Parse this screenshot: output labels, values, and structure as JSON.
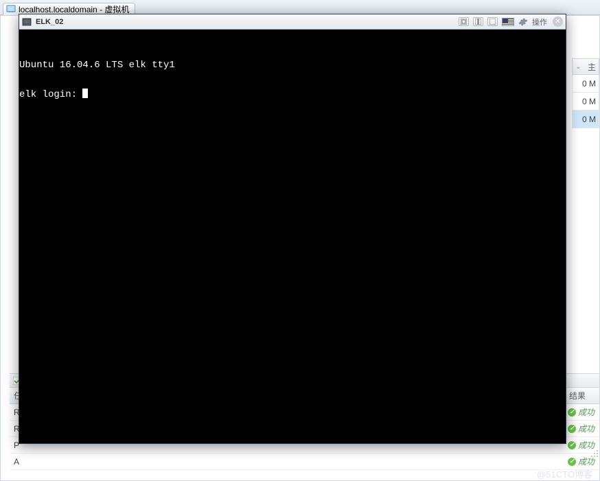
{
  "outer_tab": {
    "label": "localhost.localdomain - 虚拟机"
  },
  "sidebar": {
    "header": "主",
    "rows": [
      "0 M",
      "0 M",
      "0 M"
    ]
  },
  "tasks": {
    "header_task": "任",
    "header_result": "结果",
    "rows": [
      {
        "name": "R",
        "result": "成功"
      },
      {
        "name": "R",
        "result": "成功"
      },
      {
        "name": "P",
        "result": "成功"
      },
      {
        "name": "A",
        "result": "成功"
      }
    ]
  },
  "vm": {
    "title": "ELK_02",
    "action_label": "操作",
    "console_line1": "Ubuntu 16.04.6 LTS elk tty1",
    "console_line2": "elk login: "
  },
  "watermark": "@51CTO博客"
}
